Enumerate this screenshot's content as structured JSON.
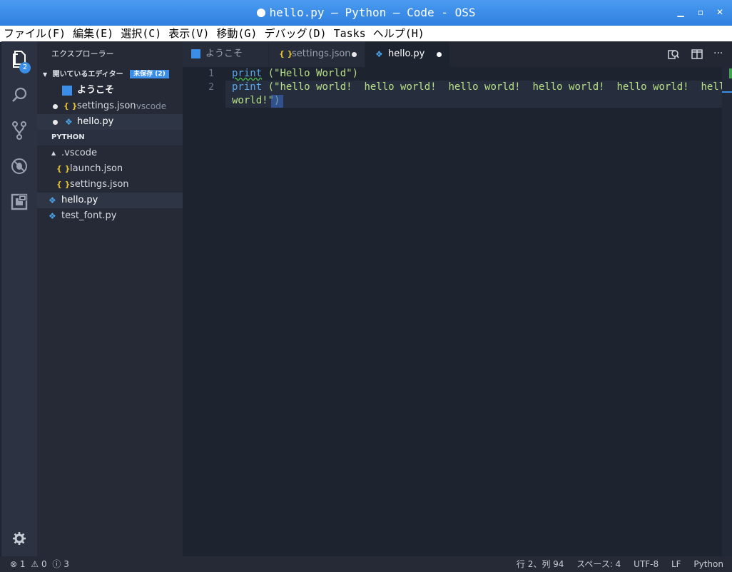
{
  "window": {
    "title": "hello.py — Python — Code - OSS"
  },
  "menu": [
    "ファイル(F)",
    "編集(E)",
    "選択(C)",
    "表示(V)",
    "移動(G)",
    "デバッグ(D)",
    "Tasks",
    "ヘルプ(H)"
  ],
  "activity": {
    "explorer_badge": "2"
  },
  "sidebar": {
    "title": "エクスプローラー",
    "open_editors": {
      "label": "開いているエディター",
      "badge": "未保存 (2)",
      "items": [
        {
          "name": "ようこそ",
          "hint": ""
        },
        {
          "name": "settings.json",
          "hint": ".vscode"
        },
        {
          "name": "hello.py",
          "hint": ""
        }
      ]
    },
    "project": {
      "label": "PYTHON",
      "folder": ".vscode",
      "files_in_folder": [
        "launch.json",
        "settings.json"
      ],
      "files": [
        "hello.py",
        "test_font.py"
      ]
    }
  },
  "tabs": [
    {
      "label": "ようこそ"
    },
    {
      "label": "settings.json"
    },
    {
      "label": "hello.py"
    }
  ],
  "editor": {
    "line_numbers": [
      "1",
      "2"
    ],
    "line1": {
      "keyword": "print",
      "rest": " (\"Hello World\")"
    },
    "line2": {
      "keyword": "print",
      "rest": " (\"hello world!  hello world!  hello world!  hello world!  hello world!  hello"
    },
    "line2_wrap": "world!\")"
  },
  "status": {
    "errors": "1",
    "warnings": "0",
    "infos": "3",
    "position": "行 2、列 94",
    "indent": "スペース: 4",
    "encoding": "UTF-8",
    "eol": "LF",
    "language": "Python"
  },
  "colors": {
    "title_bar": "#2f7fe0",
    "accent": "#3b8ee8",
    "editor_bg": "#1e2330",
    "string": "#b7e085",
    "keyword": "#5aa8e8",
    "json_icon": "#e5c22f"
  }
}
